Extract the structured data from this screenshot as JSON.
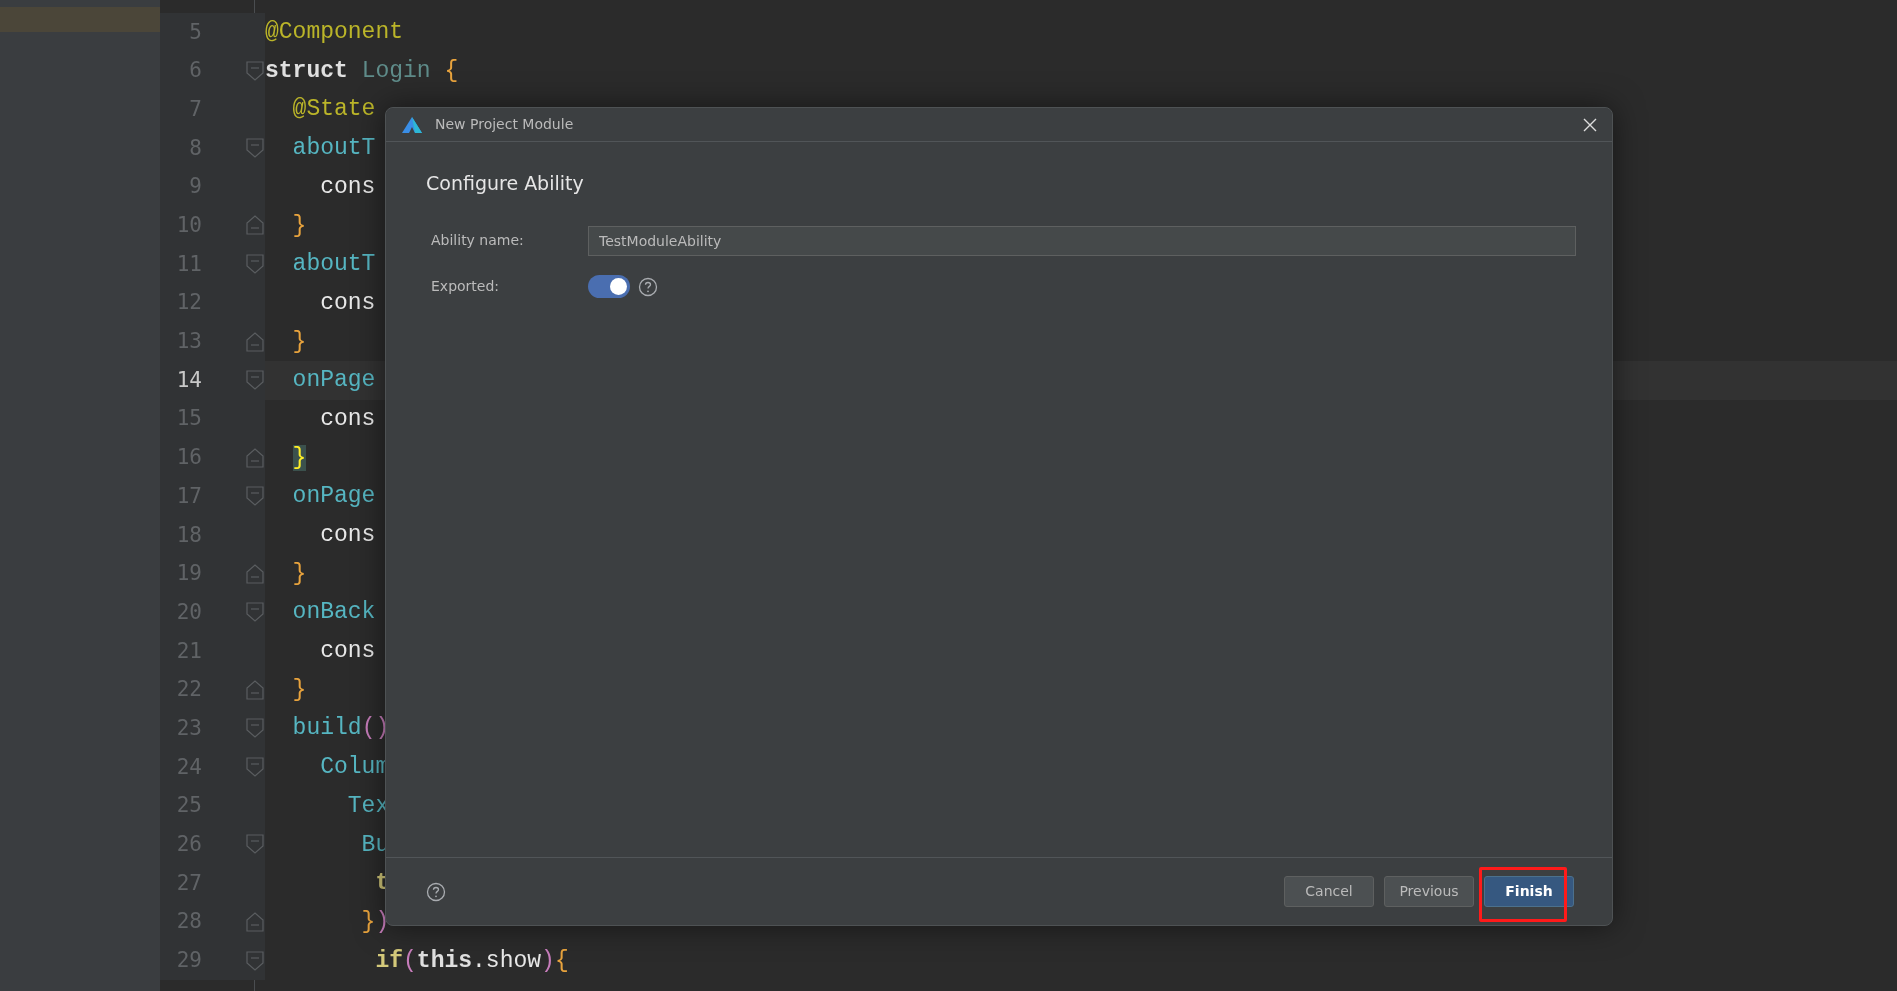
{
  "editor": {
    "lines": [
      {
        "number": "5",
        "kind": "plain",
        "tokens": [
          {
            "kind": "annotation",
            "text": "@Component"
          }
        ]
      },
      {
        "number": "6",
        "kind": "start",
        "tokens": [
          {
            "kind": "keyword",
            "text": "struct"
          },
          {
            "kind": "type",
            "text": " Login "
          },
          {
            "kind": "brace",
            "text": "{"
          }
        ]
      },
      {
        "number": "7",
        "kind": "plain",
        "tokens": [
          {
            "kind": "annotation",
            "text": "  @State"
          }
        ]
      },
      {
        "number": "8",
        "kind": "start",
        "tokens": [
          {
            "kind": "function",
            "text": "  aboutT"
          }
        ]
      },
      {
        "number": "9",
        "kind": "plain",
        "tokens": [
          {
            "kind": "plain",
            "text": "    cons"
          }
        ]
      },
      {
        "number": "10",
        "kind": "end",
        "tokens": [
          {
            "kind": "brace",
            "text": "  }"
          }
        ]
      },
      {
        "number": "11",
        "kind": "start",
        "tokens": [
          {
            "kind": "function",
            "text": "  aboutT"
          }
        ]
      },
      {
        "number": "12",
        "kind": "plain",
        "tokens": [
          {
            "kind": "plain",
            "text": "    cons"
          }
        ]
      },
      {
        "number": "13",
        "kind": "end",
        "tokens": [
          {
            "kind": "brace",
            "text": "  }"
          }
        ]
      },
      {
        "number": "14",
        "kind": "start",
        "current": true,
        "tokens": [
          {
            "kind": "function",
            "text": "  onPage"
          }
        ]
      },
      {
        "number": "15",
        "kind": "plain",
        "tokens": [
          {
            "kind": "plain",
            "text": "    cons"
          }
        ]
      },
      {
        "number": "16",
        "kind": "end",
        "tokens": [
          {
            "kind": "matched",
            "text": "  }"
          }
        ]
      },
      {
        "number": "17",
        "kind": "start",
        "tokens": [
          {
            "kind": "function",
            "text": "  onPage"
          }
        ]
      },
      {
        "number": "18",
        "kind": "plain",
        "tokens": [
          {
            "kind": "plain",
            "text": "    cons"
          }
        ]
      },
      {
        "number": "19",
        "kind": "end",
        "tokens": [
          {
            "kind": "brace",
            "text": "  }"
          }
        ]
      },
      {
        "number": "20",
        "kind": "start",
        "tokens": [
          {
            "kind": "function",
            "text": "  onBack"
          }
        ]
      },
      {
        "number": "21",
        "kind": "plain",
        "tokens": [
          {
            "kind": "plain",
            "text": "    cons"
          }
        ]
      },
      {
        "number": "22",
        "kind": "end",
        "tokens": [
          {
            "kind": "brace",
            "text": "  }"
          }
        ]
      },
      {
        "number": "23",
        "kind": "start",
        "tokens": [
          {
            "kind": "function",
            "text": "  build"
          },
          {
            "kind": "paren",
            "text": "()"
          }
        ]
      },
      {
        "number": "24",
        "kind": "start",
        "tokens": [
          {
            "kind": "function",
            "text": "    Colum"
          }
        ]
      },
      {
        "number": "25",
        "kind": "plain",
        "tokens": [
          {
            "kind": "function",
            "text": "      Tex"
          }
        ]
      },
      {
        "number": "26",
        "kind": "start",
        "tokens": [
          {
            "kind": "function",
            "text": "       Bu"
          }
        ]
      },
      {
        "number": "27",
        "kind": "plain",
        "tokens": [
          {
            "kind": "property",
            "text": "        t"
          }
        ]
      },
      {
        "number": "28",
        "kind": "end",
        "tokens": [
          {
            "kind": "brace",
            "text": "       }"
          },
          {
            "kind": "paren",
            "text": ")"
          }
        ]
      },
      {
        "number": "29",
        "kind": "start",
        "tokens": [
          {
            "kind": "property",
            "text": "        if"
          },
          {
            "kind": "paren",
            "text": "("
          },
          {
            "kind": "keyword",
            "text": "this"
          },
          {
            "kind": "plain",
            "text": ".show"
          },
          {
            "kind": "paren",
            "text": ")"
          },
          {
            "kind": "brace",
            "text": "{"
          }
        ]
      }
    ]
  },
  "dialog": {
    "title": "New Project Module",
    "heading": "Configure Ability",
    "fields": [
      {
        "kind": "text",
        "label": "Ability name:",
        "value": "TestModuleAbility"
      },
      {
        "kind": "toggle",
        "label": "Exported:",
        "on": true
      }
    ],
    "buttons": [
      {
        "label": "Cancel",
        "primary": false,
        "highlighted": false
      },
      {
        "label": "Previous",
        "primary": false,
        "highlighted": false
      },
      {
        "label": "Finish",
        "primary": true,
        "highlighted": true
      }
    ]
  }
}
